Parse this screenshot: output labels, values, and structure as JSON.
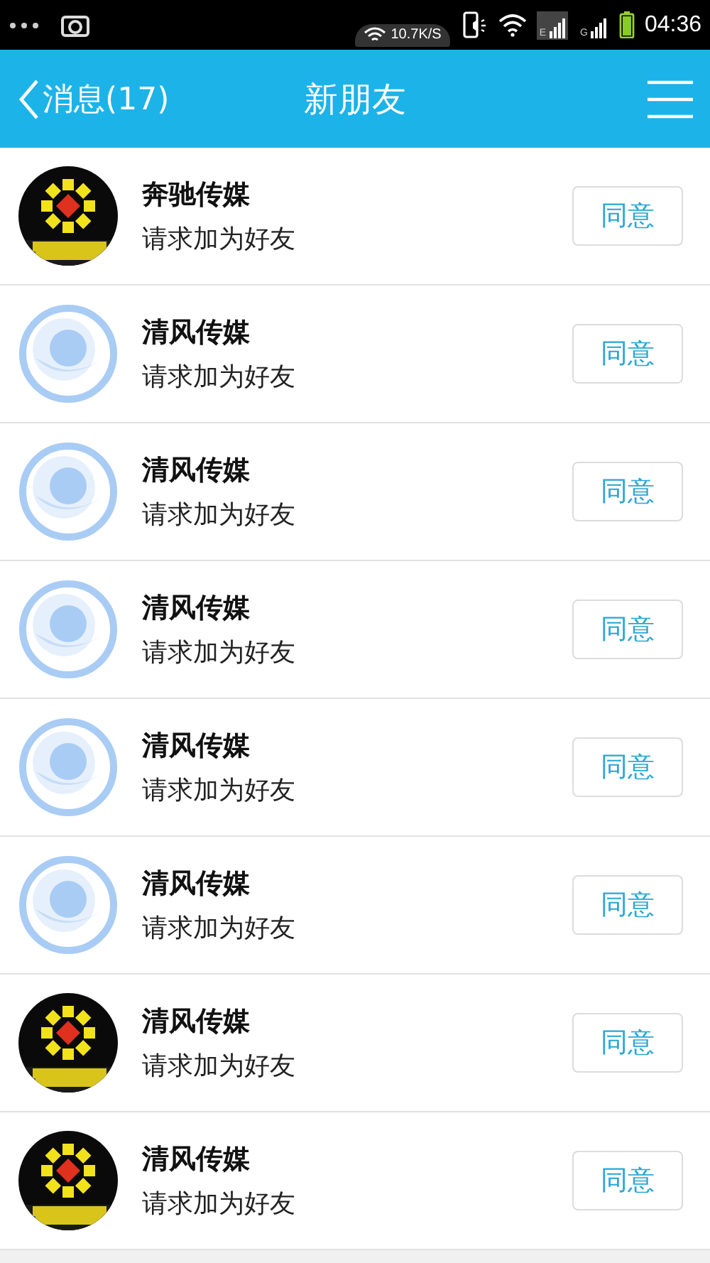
{
  "status_bar": {
    "speed": "10.7K/S",
    "time": "04:36",
    "network_1": "E",
    "network_2": "G"
  },
  "header": {
    "back": "消息(17)",
    "title": "新朋友"
  },
  "requests": [
    {
      "name": "奔驰传媒",
      "message": "请求加为好友",
      "button": "同意"
    },
    {
      "name": "清风传媒",
      "message": "请求加为好友",
      "button": "同意",
      "kind": "default"
    },
    {
      "name": "清风传媒",
      "message": "请求加为好友",
      "button": "同意",
      "kind": "default"
    },
    {
      "name": "清风传媒",
      "message": "请求加为好友",
      "button": "同意",
      "kind": "default"
    },
    {
      "name": "清风传媒",
      "message": "请求加为好友",
      "button": "同意",
      "kind": "default"
    },
    {
      "name": "清风传媒",
      "message": "请求加为好友",
      "button": "同意",
      "kind": "default"
    },
    {
      "name": "清风传媒",
      "message": "请求加为好友",
      "button": "同意"
    },
    {
      "name": "清风传媒",
      "message": "请求加为好友",
      "button": "同意"
    }
  ]
}
